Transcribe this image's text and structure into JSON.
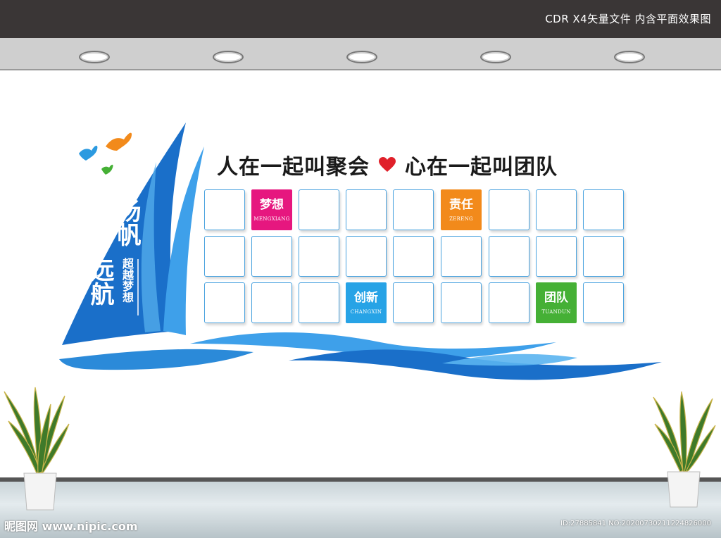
{
  "banner": {
    "text": "CDR X4矢量文件  内含平面效果图"
  },
  "headline": {
    "left": "人在一起叫聚会",
    "right": "心在一起叫团队"
  },
  "sail": {
    "title_line1": "扬帆",
    "title_line2": "远航",
    "subtitle": "超越梦想"
  },
  "tiles": [
    {
      "cn": "梦想",
      "en": "MENGXIANG",
      "color": "#e6177f"
    },
    {
      "cn": "责任",
      "en": "ZERENG",
      "color": "#f28a1b"
    },
    {
      "cn": "创新",
      "en": "CHANGXIN",
      "color": "#27a3e6"
    },
    {
      "cn": "团队",
      "en": "TUANDUN",
      "color": "#45b035"
    }
  ],
  "colors": {
    "sail_dark": "#1a6fc9",
    "sail_light": "#3ea0ea",
    "wave": "#2b8ad9",
    "heart": "#e0202a"
  },
  "watermark": {
    "left": "昵图网 www.nipic.com",
    "right": "ID:27885841 NO:20200730211224826000"
  }
}
